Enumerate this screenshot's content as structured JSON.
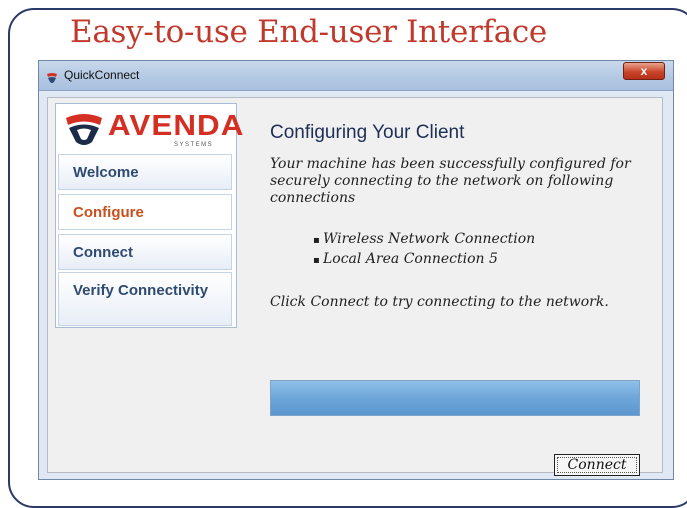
{
  "slide": {
    "title": "Easy-to-use End-user Interface"
  },
  "window": {
    "title": "QuickConnect",
    "close_label": "x"
  },
  "logo": {
    "name": "AVENDA",
    "sub": "SYSTEMS"
  },
  "sidebar": {
    "items": [
      {
        "label": "Welcome",
        "active": false
      },
      {
        "label": "Configure",
        "active": true
      },
      {
        "label": "Connect",
        "active": false
      },
      {
        "label": "Verify Connectivity",
        "active": false
      }
    ]
  },
  "main": {
    "heading": "Configuring Your Client",
    "description": "Your machine has been successfully configured for securely connecting to the network on following connections",
    "connections": [
      "Wireless Network Connection",
      "Local Area Connection 5"
    ],
    "instruction": "Click Connect to try connecting to the network.",
    "connect_button": "Connect"
  },
  "colors": {
    "title_red": "#c0392b",
    "brand_red": "#d32f23",
    "active_nav": "#c8501e",
    "nav_text": "#2f4a72"
  }
}
